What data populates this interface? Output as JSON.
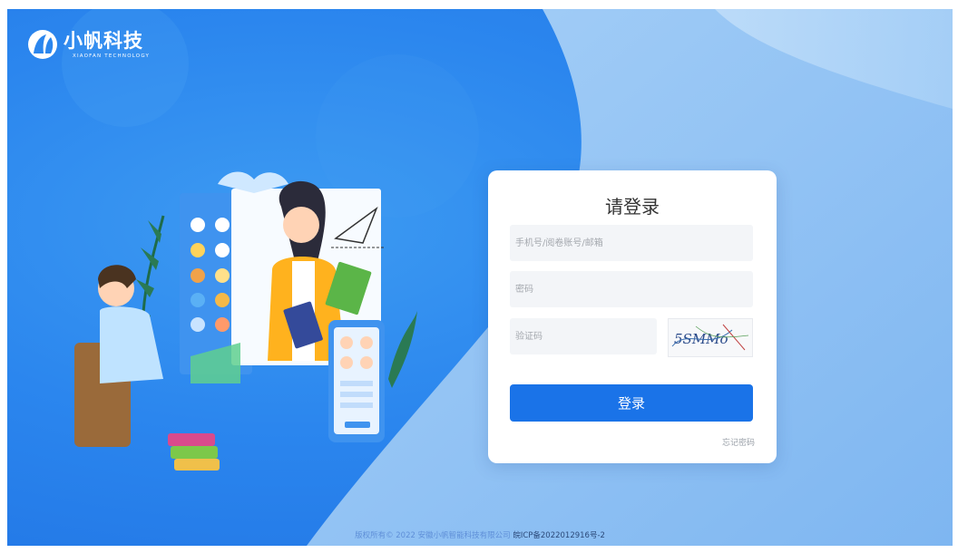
{
  "brand": {
    "name_cn": "小帆科技",
    "name_en": "XIAOFAN TECHNOLOGY"
  },
  "login": {
    "title": "请登录",
    "username_placeholder": "手机号/阅卷账号/邮箱",
    "password_placeholder": "密码",
    "captcha_placeholder": "验证码",
    "captcha_text": "5SMMo",
    "submit_label": "登录",
    "forgot_label": "忘记密码"
  },
  "footer": {
    "copyright": "版权所有© 2022 安徽小帆智能科技有限公司",
    "icp": "皖ICP备2022012916号-2"
  },
  "colors": {
    "background": "#2b86ee",
    "wave": "#8cc0f4",
    "primary_button": "#1a73e8",
    "card": "#ffffff"
  }
}
